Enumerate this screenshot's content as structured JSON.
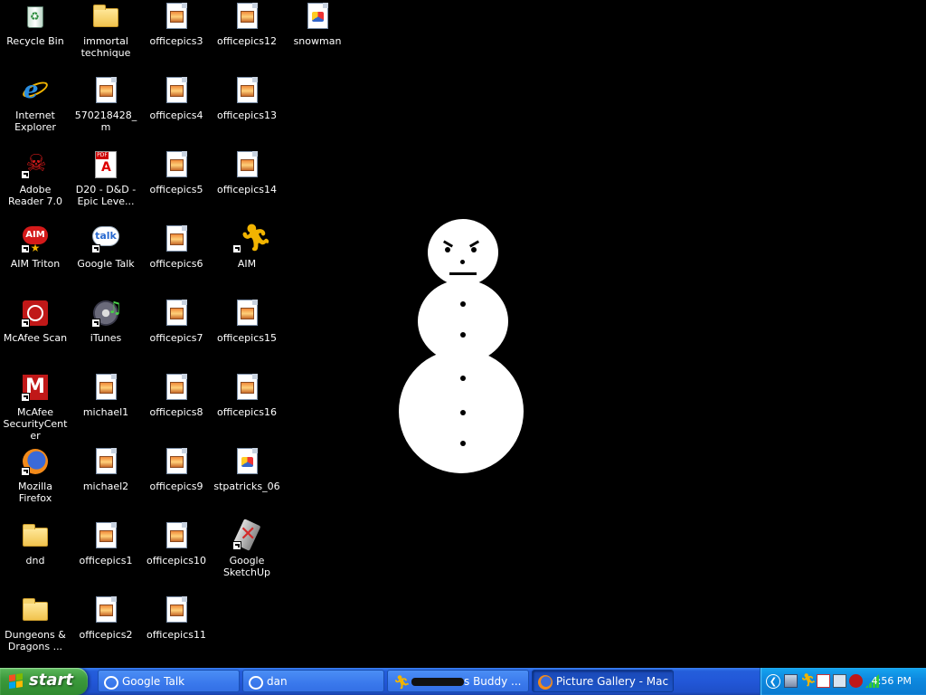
{
  "desktop": {
    "icons": [
      {
        "label": "Recycle Bin"
      },
      {
        "label": "Internet Explorer"
      },
      {
        "label": "Adobe Reader 7.0"
      },
      {
        "label": "AIM Triton"
      },
      {
        "label": "McAfee Scan"
      },
      {
        "label": "McAfee SecurityCenter"
      },
      {
        "label": "Mozilla Firefox"
      },
      {
        "label": "dnd"
      },
      {
        "label": "Dungeons & Dragons ..."
      },
      {
        "label": "immortal technique"
      },
      {
        "label": "570218428_m"
      },
      {
        "label": "D20 - D&D - Epic Leve..."
      },
      {
        "label": "Google Talk"
      },
      {
        "label": "iTunes"
      },
      {
        "label": "michael1"
      },
      {
        "label": "michael2"
      },
      {
        "label": "officepics1"
      },
      {
        "label": "officepics2"
      },
      {
        "label": "officepics3"
      },
      {
        "label": "officepics4"
      },
      {
        "label": "officepics5"
      },
      {
        "label": "officepics6"
      },
      {
        "label": "officepics7"
      },
      {
        "label": "officepics8"
      },
      {
        "label": "officepics9"
      },
      {
        "label": "officepics10"
      },
      {
        "label": "officepics11"
      },
      {
        "label": "officepics12"
      },
      {
        "label": "officepics13"
      },
      {
        "label": "officepics14"
      },
      {
        "label": "AIM"
      },
      {
        "label": "officepics15"
      },
      {
        "label": "officepics16"
      },
      {
        "label": "stpatricks_06"
      },
      {
        "label": "Google SketchUp"
      },
      {
        "label": "snowman"
      }
    ]
  },
  "taskbar": {
    "start_label": "start",
    "tasks": [
      {
        "label": "Google Talk"
      },
      {
        "label": "dan"
      },
      {
        "label": "s Buddy ..."
      },
      {
        "label": "Picture Gallery - Mac ..."
      }
    ],
    "clock": "4:56 PM"
  },
  "colors": {
    "desktop_bg": "#000000",
    "taskbar_blue": "#245edb",
    "start_green": "#3c9a3c",
    "tray_blue": "#0e8ae0"
  }
}
